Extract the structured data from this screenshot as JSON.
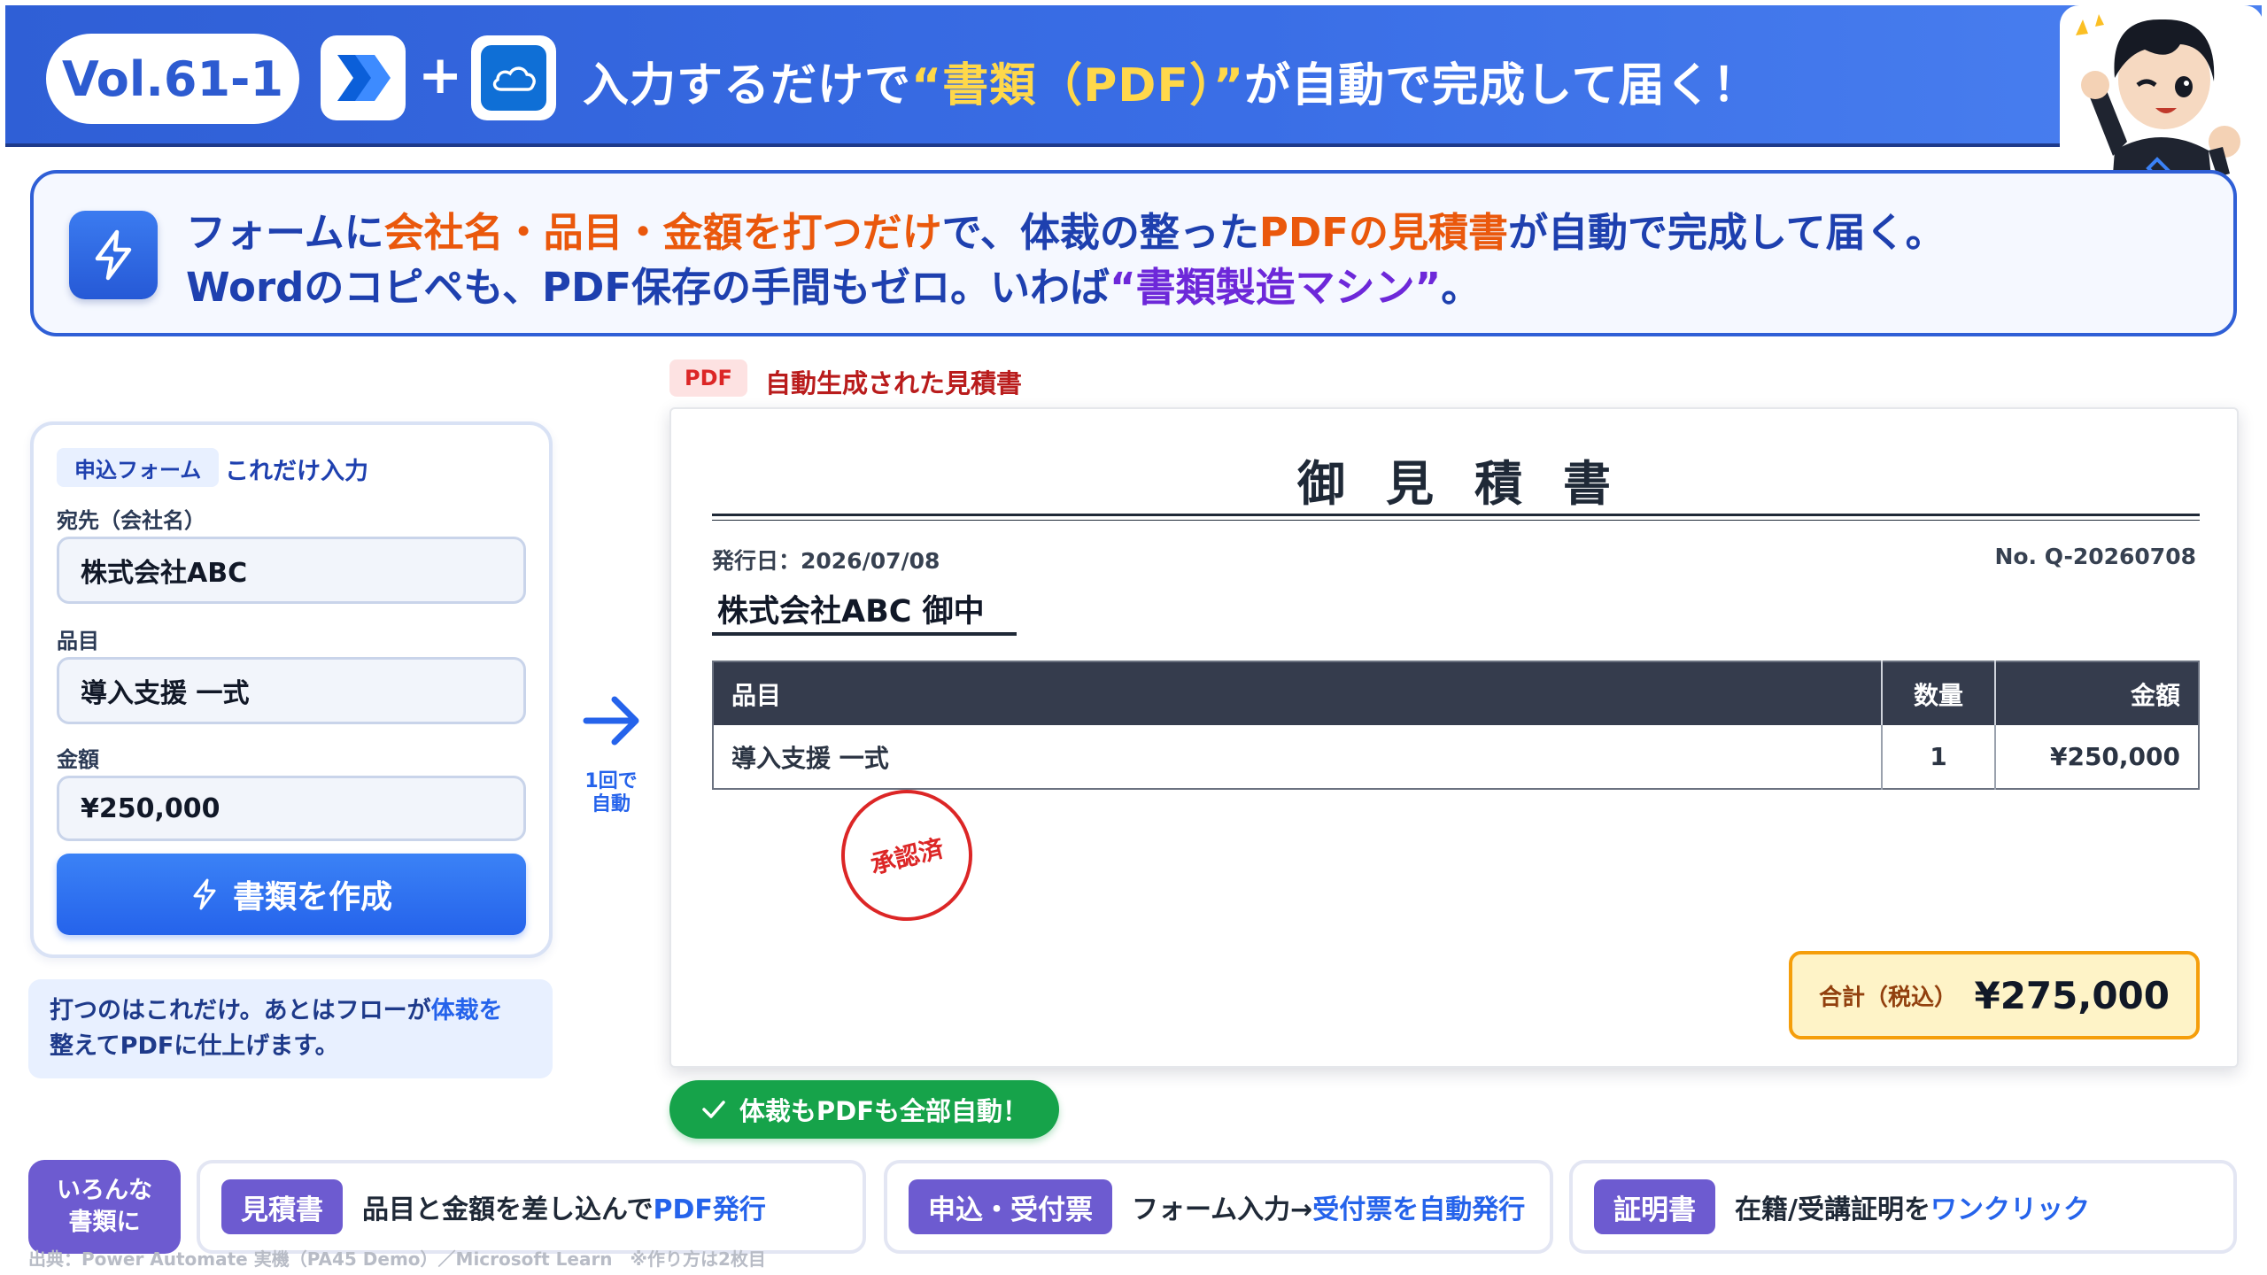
{
  "header": {
    "vol": "Vol.61-1",
    "plus": "+",
    "title_prefix": "入力するだけで",
    "title_highlight": "“書類（PDF）”",
    "title_suffix": "が自動で完成して届く！",
    "icons": [
      "power-automate-icon",
      "onedrive-icon"
    ]
  },
  "banner": {
    "line1_a": "フォームに",
    "line1_b": "会社名・品目・金額を打つだけ",
    "line1_c": "で、体裁の整った",
    "line1_d": "PDFの見積書",
    "line1_e": "が自動で完成して届く。",
    "line2_a": "Wordのコピペも、PDF保存の手間もゼロ。いわば",
    "line2_b": "“書類製造マシン”",
    "line2_c": "。"
  },
  "form": {
    "tag": "申込フォーム",
    "tag_note": "これだけ入力",
    "fields": [
      {
        "label": "宛先（会社名）",
        "value": "株式会社ABC"
      },
      {
        "label": "品目",
        "value": "導入支援 一式"
      },
      {
        "label": "金額",
        "value": "¥250,000"
      }
    ],
    "button_label": "書類を作成",
    "note_a": "打つのはこれだけ。あとはフローが",
    "note_b": "体裁を",
    "note_c": "整えてPDFに仕上げます。"
  },
  "flow": {
    "line1": "1回で",
    "line2": "自動"
  },
  "pdf": {
    "chip": "PDF",
    "caption": "自動生成された見積書",
    "title": "御見積書",
    "issue_date": "発行日：2026/07/08",
    "number": "No. Q-20260708",
    "client": "株式会社ABC 御中",
    "table": {
      "headers": [
        "品目",
        "数量",
        "金額"
      ],
      "rows": [
        [
          "導入支援 一式",
          "1",
          "¥250,000"
        ]
      ]
    },
    "stamp": "承認済",
    "total_label": "合計（税込）",
    "total_value": "¥275,000"
  },
  "auto_badge": "体裁もPDFも全部自動！",
  "usecases": {
    "head_line1": "いろんな",
    "head_line2": "書類に",
    "items": [
      {
        "tag": "見積書",
        "desc_a": "品目と金額を差し込んで",
        "desc_b": "PDF発行",
        "desc_c": ""
      },
      {
        "tag": "申込・受付票",
        "desc_a": "フォーム入力→",
        "desc_b": "受付票を自動発行",
        "desc_c": ""
      },
      {
        "tag": "証明書",
        "desc_a": "在籍/受講証明を",
        "desc_b": "ワンクリック",
        "desc_c": ""
      }
    ]
  },
  "source": "出典：Power Automate 実機（PA45 Demo）／Microsoft Learn　※作り方は2枚目",
  "colors": {
    "header_blue": "#2f5fd6",
    "highlight_yellow": "#ffd84a",
    "accent_orange": "#ea580c",
    "accent_purple": "#6d28d9",
    "primary_blue": "#2563eb",
    "stamp_red": "#dc2626",
    "success_green": "#16a34a",
    "usecase_purple": "#6d5bd0"
  }
}
